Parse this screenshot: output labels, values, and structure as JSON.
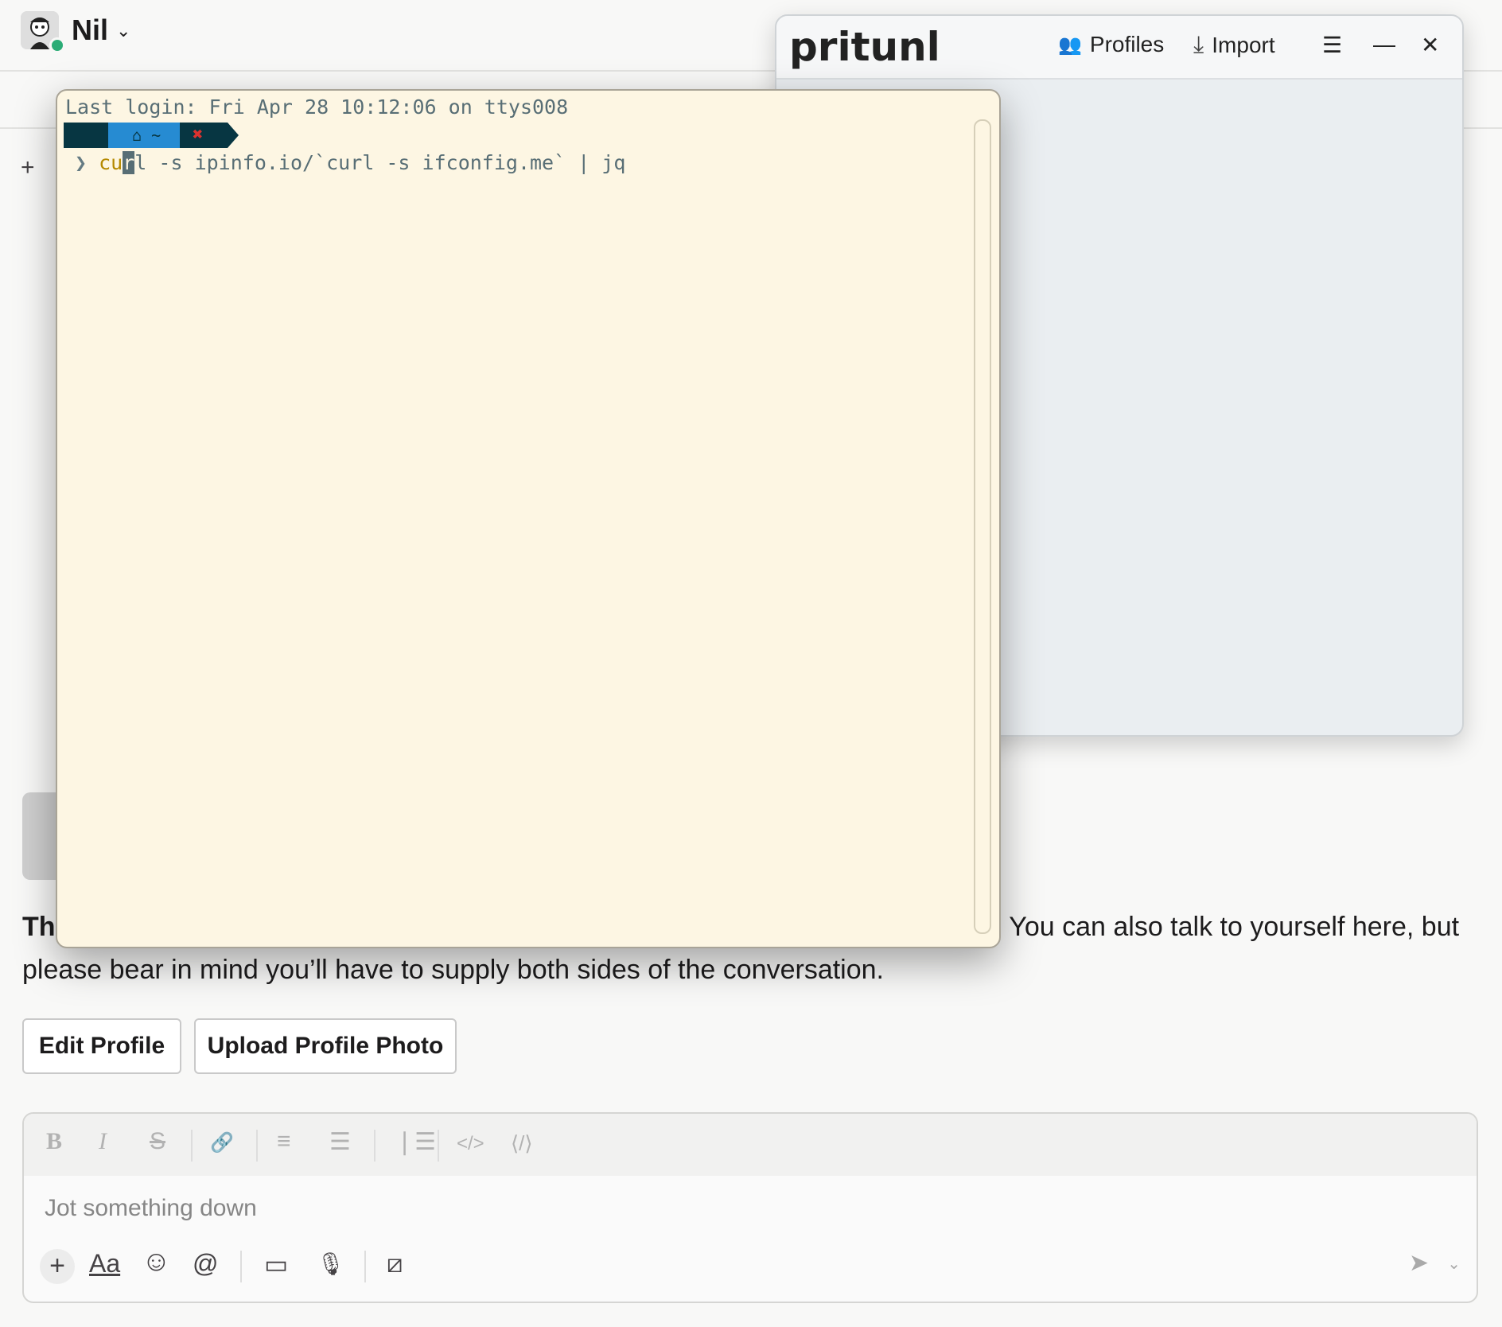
{
  "slack": {
    "user_name": "Nil",
    "intro_prefix": "Th",
    "intro_line1_tail": ". You can also talk to yourself here, but",
    "intro_line2": "please bear in mind you’ll have to supply both sides of the conversation.",
    "edit_profile": "Edit Profile",
    "upload_photo": "Upload Profile Photo",
    "composer_placeholder": "Jot something down",
    "format_icons": [
      "bold-icon",
      "italic-icon",
      "strikethrough-icon",
      "link-icon",
      "ordered-list-icon",
      "bulleted-list-icon",
      "blockquote-icon",
      "code-icon",
      "code-block-icon"
    ],
    "composer_controls": [
      "plus-icon",
      "format-text-icon",
      "emoji-icon",
      "mention-icon",
      "video-icon",
      "microphone-icon",
      "shortcut-icon",
      "send-icon"
    ],
    "format_glyphs": {
      "bold": "B",
      "italic": "I",
      "strike": "S",
      "link": "🔗",
      "ol": "⅟",
      "ul": "☰",
      "quote": "❘☰",
      "code": "</>",
      "codeblock": "⟨/⟩"
    },
    "ctl_glyphs": {
      "plus": "+",
      "aa": "Aa",
      "emoji": "☺",
      "mention": "@",
      "video": "▭",
      "mic": "🎙",
      "shortcut": "⧄",
      "send": "➤",
      "chev": "⌄",
      "bookmark_plus": "+"
    }
  },
  "pritunl": {
    "logo": "pritunl",
    "profiles_label": "Profiles",
    "import_label": "Import",
    "icons": [
      "profiles-icon",
      "import-icon",
      "menu-icon",
      "minimize-icon",
      "close-icon"
    ],
    "glyphs": {
      "profiles": "👥",
      "import": "⤓",
      "menu": "☰",
      "min": "—",
      "close": "✕"
    }
  },
  "terminal": {
    "last_login": "Last login: Fri Apr 28 10:12:06 on ttys008",
    "prompt_glyphs": {
      "apple": "",
      "home": "⌂  ~",
      "error": "✖"
    },
    "caret": "❯",
    "cmd_pre": "cu",
    "cmd_cursor": "r",
    "cmd_post": "l",
    "cmd_rest": " -s ipinfo.io/`curl -s ifconfig.me` | jq"
  },
  "colors": {
    "terminal_bg": "#fdf6e3",
    "prompt_dark": "#073642",
    "prompt_blue": "#268bd2",
    "error_red": "#dc322f",
    "presence_green": "#2bac76"
  }
}
